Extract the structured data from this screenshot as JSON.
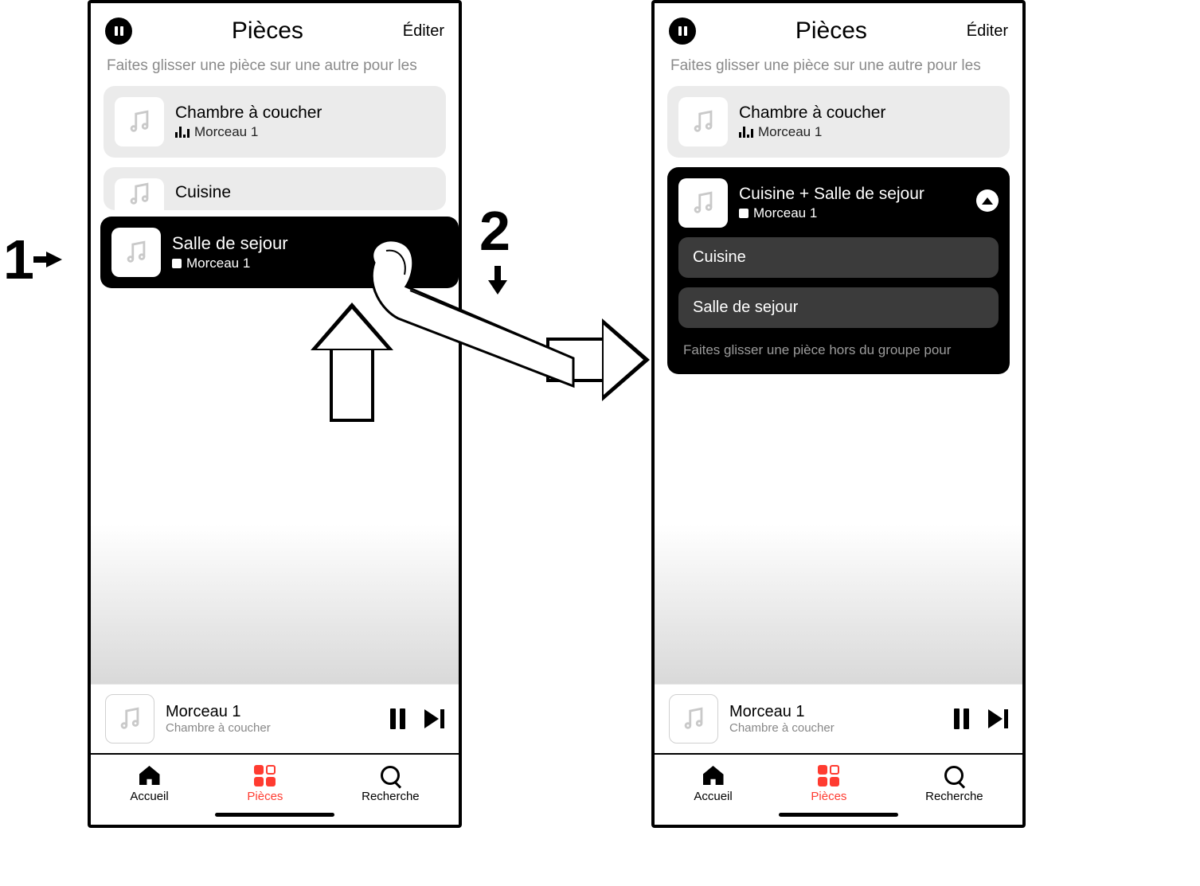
{
  "steps": {
    "one": "1",
    "two": "2"
  },
  "screen1": {
    "header": {
      "title": "Pièces",
      "edit": "Éditer"
    },
    "hint": "Faites glisser une pièce sur une autre pour les",
    "rooms": {
      "bedroom": {
        "name": "Chambre à coucher",
        "track": "Morceau 1"
      },
      "kitchen": {
        "name": "Cuisine"
      },
      "dragging": {
        "name": "Salle de sejour",
        "track": "Morceau 1"
      }
    },
    "nowPlaying": {
      "title": "Morceau 1",
      "sub": "Chambre à coucher"
    },
    "tabs": {
      "home": "Accueil",
      "rooms": "Pièces",
      "search": "Recherche"
    }
  },
  "screen2": {
    "header": {
      "title": "Pièces",
      "edit": "Éditer"
    },
    "hint": "Faites glisser une pièce sur une autre pour les",
    "rooms": {
      "bedroom": {
        "name": "Chambre à coucher",
        "track": "Morceau 1"
      }
    },
    "group": {
      "name": "Cuisine + Salle de sejour",
      "track": "Morceau 1",
      "members": {
        "a": "Cuisine",
        "b": "Salle de sejour"
      },
      "hint": "Faites glisser une pièce hors du groupe pour"
    },
    "nowPlaying": {
      "title": "Morceau 1",
      "sub": "Chambre à coucher"
    },
    "tabs": {
      "home": "Accueil",
      "rooms": "Pièces",
      "search": "Recherche"
    }
  }
}
